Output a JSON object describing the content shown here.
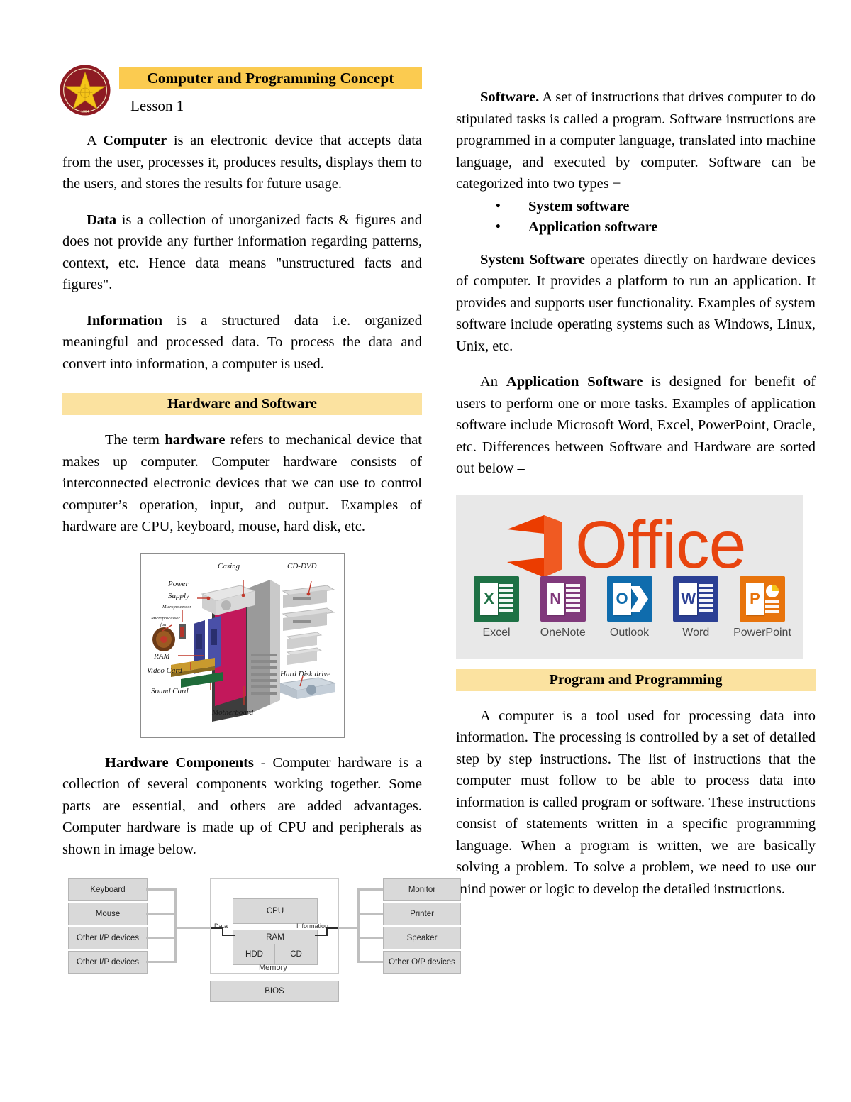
{
  "document": {
    "title": "Computer and Programming Concept",
    "lesson": "Lesson 1",
    "logo_alt": "polytechnic-university-seal",
    "colors": {
      "title_band": "#FBCB50",
      "section_band": "#FBE2A0",
      "text": "#000000",
      "office_orange": "#E8440F"
    }
  },
  "left_column": {
    "para_computer": {
      "lead": "A ",
      "bold": "Computer",
      "rest": " is an electronic device that accepts data from the user, processes it, produces results, displays them to the users, and stores the results for future usage."
    },
    "para_data": {
      "bold": "Data",
      "rest": " is a collection of unorganized facts & figures and does not provide any further information regarding patterns, context, etc. Hence data means \"unstructured facts and figures\"."
    },
    "para_information": {
      "bold": "Information",
      "rest": " is a structured data i.e. organized meaningful and processed data. To process the data and convert into information, a computer is used."
    },
    "section_hardware_software": "Hardware and Software",
    "para_hardware": {
      "lead": "The term ",
      "bold": "hardware",
      "rest": " refers to mechanical device that makes up computer. Computer hardware consists of interconnected electronic devices that we can use to control computer’s operation, input, and output. Examples of hardware are CPU, keyboard, mouse, hard disk, etc."
    },
    "figure_hardware": {
      "name": "exploded-computer-diagram",
      "labels": [
        "Casing",
        "CD-DVD",
        "Power",
        "Supply",
        "Microprocessor",
        "Microprocessor fan",
        "RAM",
        "Video Card",
        "Sound Card",
        "Hard Disk drive",
        "Motherboard"
      ]
    },
    "para_components": {
      "bold": "Hardware Components",
      "rest": " -  Computer hardware is a collection of several components working together. Some parts are essential, and others are added advantages. Computer hardware is made up of CPU and peripherals as shown in image below."
    },
    "figure_block": {
      "name": "computer-block-diagram",
      "inputs": [
        "Keyboard",
        "Mouse",
        "Other I/P devices",
        "Other I/P devices"
      ],
      "core": [
        "CPU",
        "RAM",
        "HDD",
        "CD"
      ],
      "core_caption": "Memory",
      "outputs": [
        "Monitor",
        "Printer",
        "Speaker",
        "Other O/P devices"
      ],
      "bios": "BIOS",
      "flow_in": "Data",
      "flow_out": "Information"
    }
  },
  "right_column": {
    "para_software": {
      "bold": "Software.",
      "rest": " A set of instructions that drives computer to do stipulated tasks is called a program. Software instructions are programmed in a computer language, translated into machine language, and executed by computer. Software can be categorized into two types −"
    },
    "software_types": [
      "System software",
      "Application software"
    ],
    "para_system_software": {
      "bold": "System Software",
      "rest": " operates directly on hardware devices of computer. It provides a platform to run an application. It provides and supports user functionality. Examples of system software include operating systems such as Windows, Linux, Unix, etc."
    },
    "para_application_software": {
      "lead": "An ",
      "bold": "Application Software",
      "rest": " is designed for benefit of users to perform one or more tasks. Examples of application software include Microsoft Word, Excel, PowerPoint, Oracle, etc. Differences between Software and Hardware are sorted out below –"
    },
    "figure_office": {
      "name": "microsoft-office-banner",
      "wordmark": "Office",
      "apps": [
        {
          "label": "Excel",
          "letter": "X",
          "color": "#1E7145"
        },
        {
          "label": "OneNote",
          "letter": "N",
          "color": "#80397B"
        },
        {
          "label": "Outlook",
          "letter": "O",
          "color": "#0F6CAD"
        },
        {
          "label": "Word",
          "letter": "W",
          "color": "#2B3F94"
        },
        {
          "label": "PowerPoint",
          "letter": "P",
          "color": "#E8740C"
        }
      ]
    },
    "section_program_programming": "Program and Programming",
    "para_program": "A computer is a tool used for processing data into information. The processing is controlled by a set of detailed step by step instructions. The list of instructions that the computer must follow to be able to process data into information is called program or software. These instructions consist of statements written in a specific programming language. When a program is written, we are basically solving a problem. To solve a problem, we need to use our mind power or logic to develop the detailed instructions."
  }
}
